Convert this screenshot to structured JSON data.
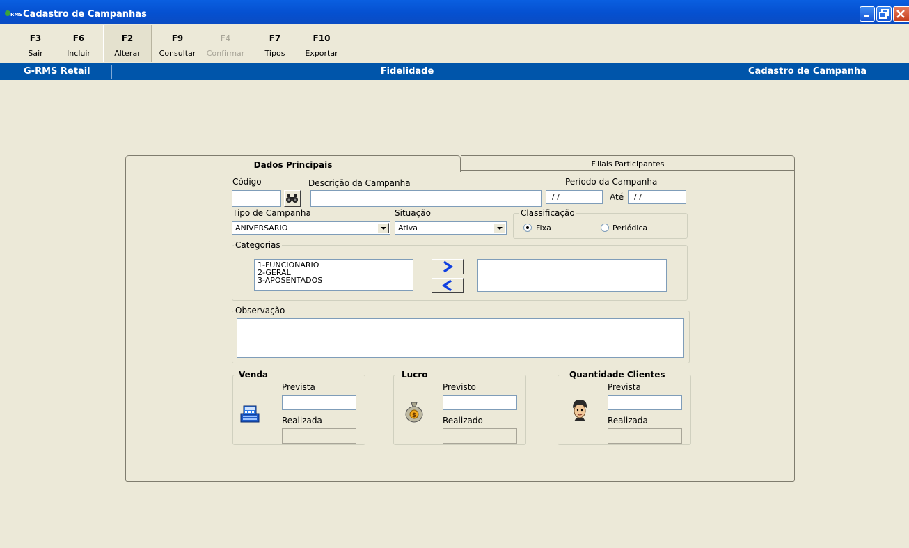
{
  "window": {
    "title": "Cadastro de Campanhas",
    "app_icon_text": "RMS"
  },
  "toolbar": {
    "items": [
      {
        "key": "F3",
        "label": "Sair"
      },
      {
        "key": "F6",
        "label": "Incluir"
      },
      {
        "key": "F2",
        "label": "Alterar"
      },
      {
        "key": "F9",
        "label": "Consultar"
      },
      {
        "key": "F4",
        "label": "Confirmar"
      },
      {
        "key": "F7",
        "label": "Tipos"
      },
      {
        "key": "F10",
        "label": "Exportar"
      }
    ]
  },
  "header_bar": {
    "left": "G-RMS Retail",
    "center": "Fidelidade",
    "right": "Cadastro de Campanha"
  },
  "tabs": [
    {
      "label": "Dados Principais",
      "active": true
    },
    {
      "label": "Filiais Participantes",
      "active": false
    }
  ],
  "form": {
    "codigo": {
      "label": "Código",
      "value": ""
    },
    "descricao": {
      "label": "Descrição da Campanha",
      "value": ""
    },
    "periodo": {
      "label": "Período da Campanha",
      "from": "/ /",
      "to_label": "Até",
      "to": "/ /"
    },
    "tipo": {
      "label": "Tipo de Campanha",
      "value": "ANIVERSARIO"
    },
    "situacao": {
      "label": "Situação",
      "value": "Ativa"
    },
    "classificacao": {
      "label": "Classificação",
      "options": [
        "Fixa",
        "Periódica"
      ],
      "selected": "Fixa"
    },
    "categorias": {
      "label": "Categorias",
      "available": [
        "1-FUNCIONARIO",
        "2-GERAL",
        "3-APOSENTADOS"
      ],
      "selected": []
    },
    "observacao": {
      "label": "Observação",
      "value": ""
    },
    "venda": {
      "label": "Venda",
      "prevista_label": "Prevista",
      "realizada_label": "Realizada",
      "icon": "cash-register-icon"
    },
    "lucro": {
      "label": "Lucro",
      "previsto_label": "Previsto",
      "realizado_label": "Realizado",
      "icon": "money-bag-icon"
    },
    "clientes": {
      "label": "Quantidade Clientes",
      "prevista_label": "Prevista",
      "realizada_label": "Realizada",
      "icon": "customer-face-icon"
    }
  },
  "colors": {
    "title_bar": "#0A5FE0",
    "header_bar": "#0055AA",
    "window_bg": "#ECE9D8",
    "arrow_blue": "#1040E0"
  }
}
